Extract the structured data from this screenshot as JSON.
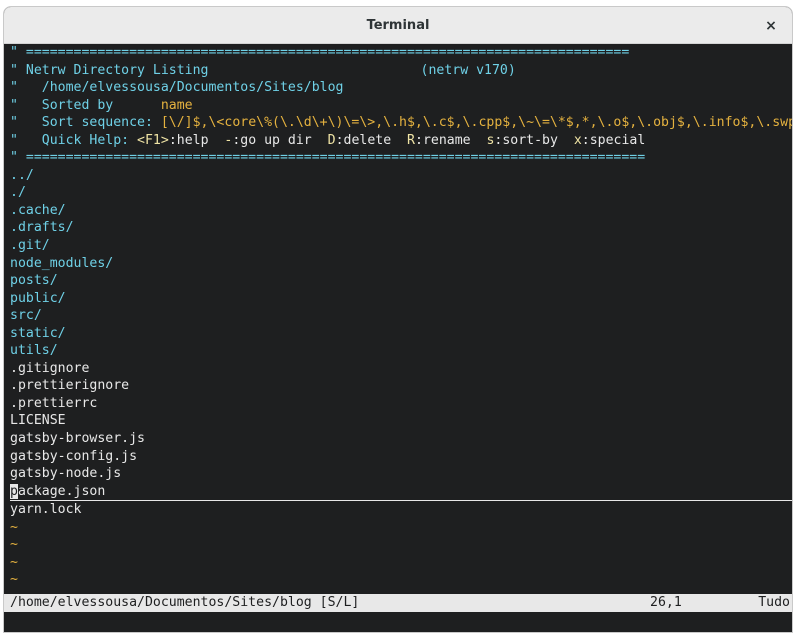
{
  "window": {
    "title": "Terminal",
    "close_glyph": "×"
  },
  "header": {
    "rule_top": "\" ============================================================================",
    "rule_bottom": "\" ==============================================================================",
    "listing_prefix": "\" Netrw Directory Listing",
    "version": "(netrw v170)",
    "path_prefix": "\"   ",
    "path": "/home/elvessousa/Documentos/Sites/blog",
    "sorted_prefix": "\"   Sorted by      ",
    "sorted_value": "name",
    "sortseq_prefix": "\"   Sort sequence: ",
    "sortseq_value": "[\\/]$,\\<core\\%(\\.\\d\\+\\)\\=\\>,\\.h$,\\.c$,\\.cpp$,\\~\\=\\*$,*,\\.o$,\\.obj$,\\.info$,\\.swp$",
    "quickhelp_prefix": "\"   Quick Help: ",
    "quickhelp": [
      {
        "key": "<F1>",
        "desc": ":help  "
      },
      {
        "key": "-",
        "desc": ":go up dir  "
      },
      {
        "key": "D",
        "desc": ":delete  "
      },
      {
        "key": "R",
        "desc": ":rename  "
      },
      {
        "key": "s",
        "desc": ":sort-by  "
      },
      {
        "key": "x",
        "desc": ":special"
      }
    ]
  },
  "entries": {
    "dirs": [
      "../",
      "./",
      ".cache/",
      ".drafts/",
      ".git/",
      "node_modules/",
      "posts/",
      "public/",
      "src/",
      "static/",
      "utils/"
    ],
    "files_top": [
      ".gitignore",
      ".prettierignore",
      ".prettierrc",
      "LICENSE",
      "gatsby-browser.js",
      "gatsby-config.js",
      "gatsby-node.js"
    ],
    "current_first_char": "p",
    "current_rest": "ackage.json",
    "files_bottom": [
      "yarn.lock"
    ]
  },
  "tilde": "~",
  "statusline": {
    "path": "/home/elvessousa/Documentos/Sites/blog [S/L]",
    "position": "26,1",
    "scroll": "Tudo"
  }
}
